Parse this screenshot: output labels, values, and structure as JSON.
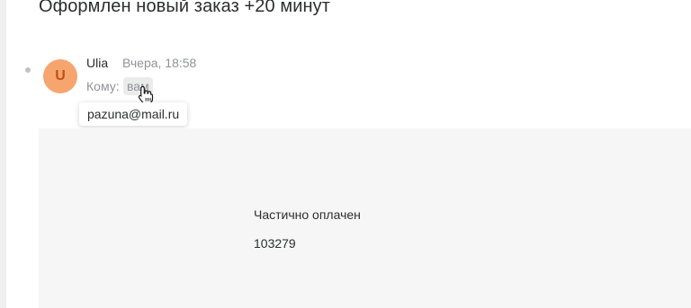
{
  "message": {
    "subject": "Оформлен новый заказ +20 минут",
    "sender": {
      "avatar_letter": "U",
      "avatar_color": "#f6a56e",
      "name": "Ulia",
      "date": "Вчера, 18:58"
    },
    "recipient": {
      "label": "Кому:",
      "value": "вам",
      "tooltip_email": "pazuna@mail.ru"
    },
    "body": {
      "status": "Частично оплачен",
      "order_number": "103279"
    }
  },
  "icons": {
    "cursor": "hand-pointer-icon",
    "unread": "unread-dot-icon"
  }
}
